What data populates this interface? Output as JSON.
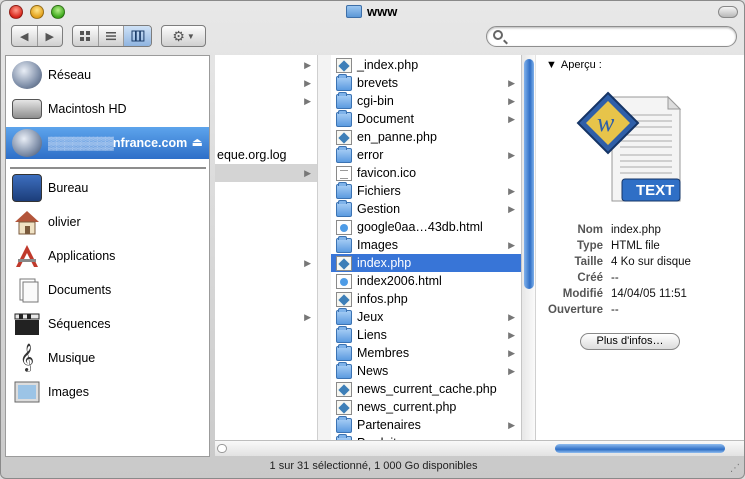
{
  "window": {
    "title": "www"
  },
  "toolbar": {
    "back_icon": "back-arrow-icon",
    "forward_icon": "forward-arrow-icon",
    "view_icons": [
      "icon-view-icon",
      "list-view-icon",
      "column-view-icon"
    ],
    "action_icon": "gear-icon",
    "search_placeholder": ""
  },
  "sidebar": {
    "devices": [
      {
        "label": "Réseau",
        "icon": "network-globe-icon"
      },
      {
        "label": "Macintosh HD",
        "icon": "hard-disk-icon"
      },
      {
        "label_hidden": "▓▓▓▓▓▓▓▓",
        "label": "nfrance.com",
        "icon": "network-volume-icon",
        "selected": true,
        "eject": "⏏"
      }
    ],
    "places": [
      {
        "label": "Bureau",
        "icon": "desktop-icon"
      },
      {
        "label": "olivier",
        "icon": "home-icon"
      },
      {
        "label": "Applications",
        "icon": "applications-icon"
      },
      {
        "label": "Documents",
        "icon": "documents-icon"
      },
      {
        "label": "Séquences",
        "icon": "movies-icon"
      },
      {
        "label": "Musique",
        "icon": "music-icon"
      },
      {
        "label": "Images",
        "icon": "pictures-icon"
      }
    ]
  },
  "column1": {
    "items": [
      {
        "label": "",
        "arrow": "▶"
      },
      {
        "label": "",
        "arrow": "▶"
      },
      {
        "label": "",
        "arrow": "▶"
      },
      {
        "label": "eque.org.log",
        "arrow": ""
      },
      {
        "label": "",
        "arrow": "▶",
        "selected": true
      },
      {
        "label": "",
        "arrow": "▶"
      },
      {
        "label": "",
        "arrow": "▶"
      },
      {
        "label": "",
        "arrow": "▶"
      },
      {
        "label": "",
        "arrow": "▶"
      },
      {
        "label": "",
        "arrow": "▶"
      },
      {
        "label": "",
        "arrow": "▶"
      }
    ]
  },
  "column2": {
    "items": [
      {
        "label": "_index.php",
        "type": "php",
        "arrow": ""
      },
      {
        "label": "brevets",
        "type": "folder",
        "arrow": "▶"
      },
      {
        "label": "cgi-bin",
        "type": "folder",
        "arrow": "▶"
      },
      {
        "label": "Document",
        "type": "folder",
        "arrow": "▶"
      },
      {
        "label": "en_panne.php",
        "type": "php",
        "arrow": ""
      },
      {
        "label": "error",
        "type": "folder",
        "arrow": "▶"
      },
      {
        "label": "favicon.ico",
        "type": "doc",
        "arrow": ""
      },
      {
        "label": "Fichiers",
        "type": "folder",
        "arrow": "▶"
      },
      {
        "label": "Gestion",
        "type": "folder",
        "arrow": "▶"
      },
      {
        "label": "google0aa…43db.html",
        "type": "html",
        "arrow": ""
      },
      {
        "label": "Images",
        "type": "folder",
        "arrow": "▶"
      },
      {
        "label": "index.php",
        "type": "php",
        "arrow": "",
        "selected": true
      },
      {
        "label": "index2006.html",
        "type": "html",
        "arrow": ""
      },
      {
        "label": "infos.php",
        "type": "php",
        "arrow": ""
      },
      {
        "label": "Jeux",
        "type": "folder",
        "arrow": "▶"
      },
      {
        "label": "Liens",
        "type": "folder",
        "arrow": "▶"
      },
      {
        "label": "Membres",
        "type": "folder",
        "arrow": "▶"
      },
      {
        "label": "News",
        "type": "folder",
        "arrow": "▶"
      },
      {
        "label": "news_current_cache.php",
        "type": "php",
        "arrow": ""
      },
      {
        "label": "news_current.php",
        "type": "php",
        "arrow": ""
      },
      {
        "label": "Partenaires",
        "type": "folder",
        "arrow": "▶"
      },
      {
        "label": "Produits",
        "type": "folder",
        "arrow": "▶"
      }
    ]
  },
  "preview": {
    "heading": "Aperçu :",
    "heading_arrow": "▼",
    "badge": "TEXT",
    "info": [
      {
        "label": "Nom",
        "value": "index.php"
      },
      {
        "label": "Type",
        "value": "HTML file"
      },
      {
        "label": "Taille",
        "value": "4 Ko sur disque"
      },
      {
        "label": "Créé",
        "value": "--"
      },
      {
        "label": "Modifié",
        "value": "14/04/05 11:51"
      },
      {
        "label": "Ouverture",
        "value": "--"
      }
    ],
    "more_button": "Plus d'infos…"
  },
  "status_bar": {
    "text": "1 sur 31 sélectionné, 1 000 Go disponibles"
  },
  "colors": {
    "selection": "#3875d7",
    "sidebar_selection": "#2e6fc8"
  }
}
